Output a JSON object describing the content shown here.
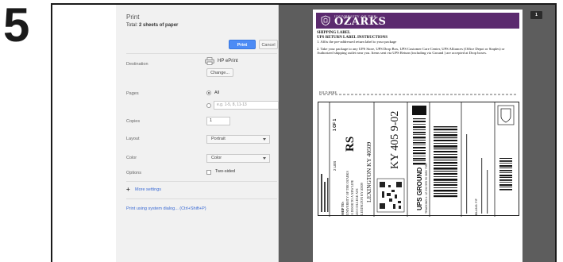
{
  "step_number": "5",
  "print_panel": {
    "title": "Print",
    "total_prefix": "Total: ",
    "total_value": "2 sheets of paper",
    "print_button": "Print",
    "cancel_button": "Cancel",
    "destination": {
      "label": "Destination",
      "printer_name": "HP ePrint",
      "change_button": "Change..."
    },
    "pages": {
      "label": "Pages",
      "all_option": "All",
      "range_placeholder": "e.g. 1-5, 8, 11-13"
    },
    "copies": {
      "label": "Copies",
      "value": "1"
    },
    "layout": {
      "label": "Layout",
      "value": "Portrait"
    },
    "color": {
      "label": "Color",
      "value": "Color"
    },
    "options": {
      "label": "Options",
      "two_sided": "Two-sided"
    },
    "more_settings": {
      "icon": "plus-icon",
      "label": "More settings"
    },
    "system_dialog_link": "Print using system dialog... (Ctrl+Shift+P)"
  },
  "preview": {
    "page_badge": "1",
    "banner": {
      "small_text": "UNIVERSITY OF THE",
      "big_text": "OZARKS",
      "color": "#5b2a6e"
    },
    "heading_1": "SHIPPING LABEL",
    "heading_2": "UPS RETURN LABEL INSTRUCTIONS",
    "step_1": "1. Affix the pre-addressed return label to your package",
    "step_2": "2. Take your package to any UPS Store, UPS Drop Box, UPS Customer Care Center, UPS Alliances (Office Depot or Staples) or Authorized shipping outlet near you. Items sent via UPS Return (including via Ground ) are accepted at Drop boxes.",
    "cut_text": "FOLD HERE",
    "label": {
      "page_count": "1 OF 1",
      "weight": "2 LBS",
      "rs_code": "RS",
      "ship_to_prefix": "SHIP TO:",
      "ship_to_lines": [
        "UNIVERSITY OF THE OZARKS",
        "A DOOR TO A NEW LIFE",
        "415 COLLEGE AVE",
        "LEXINGTON KY 40509"
      ],
      "city_line": "LEXINGTON KY 40509",
      "routing_code": "KY 405 9-02",
      "service": "UPS GROUND",
      "tracking": "TRACKING #: 1Z 2X2 595 90 3850 7530",
      "billing": "BILLING: P/P"
    }
  }
}
